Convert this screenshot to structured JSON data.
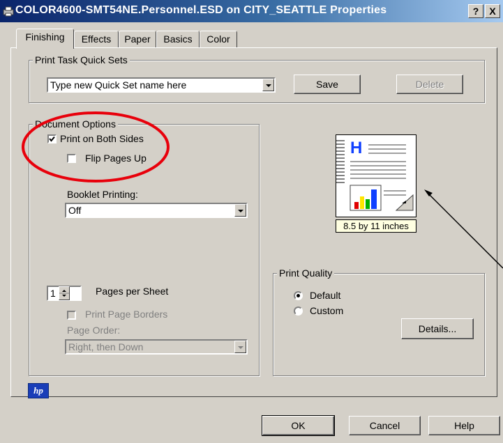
{
  "window": {
    "title": "COLOR4600-SMT54NE.Personnel.ESD on CITY_SEATTLE Properties",
    "help_btn": "?",
    "close_btn": "X"
  },
  "tabs": [
    {
      "label": "Finishing",
      "active": true
    },
    {
      "label": "Effects",
      "active": false
    },
    {
      "label": "Paper",
      "active": false
    },
    {
      "label": "Basics",
      "active": false
    },
    {
      "label": "Color",
      "active": false
    }
  ],
  "quick_sets": {
    "group_label": "Print Task Quick Sets",
    "input_value": "Type new Quick Set name here",
    "save_label": "Save",
    "delete_label": "Delete"
  },
  "document_options": {
    "group_label": "Document Options",
    "print_both_sides": {
      "label": "Print on Both Sides",
      "checked": true
    },
    "flip_pages_up": {
      "label": "Flip Pages Up",
      "checked": false
    },
    "booklet_label": "Booklet Printing:",
    "booklet_value": "Off",
    "pages_per_sheet_value": "1",
    "pages_per_sheet_label": "Pages per Sheet",
    "print_page_borders": {
      "label": "Print Page Borders",
      "checked": false,
      "disabled": true
    },
    "page_order_label": "Page Order:",
    "page_order_value": "Right, then Down"
  },
  "preview": {
    "size_label": "8.5 by 11 inches",
    "letter": "H"
  },
  "print_quality": {
    "group_label": "Print Quality",
    "options": [
      {
        "label": "Default",
        "selected": true
      },
      {
        "label": "Custom",
        "selected": false
      }
    ],
    "details_label": "Details..."
  },
  "footer": {
    "logo_text": "hp",
    "ok_label": "OK",
    "cancel_label": "Cancel",
    "help_label": "Help"
  },
  "colors": {
    "titlebar_start": "#0a246a",
    "titlebar_end": "#a6caf0",
    "dialog_face": "#d4d0c8",
    "annotation_red": "#e8000b",
    "tooltip_bg": "#ffffe1"
  }
}
